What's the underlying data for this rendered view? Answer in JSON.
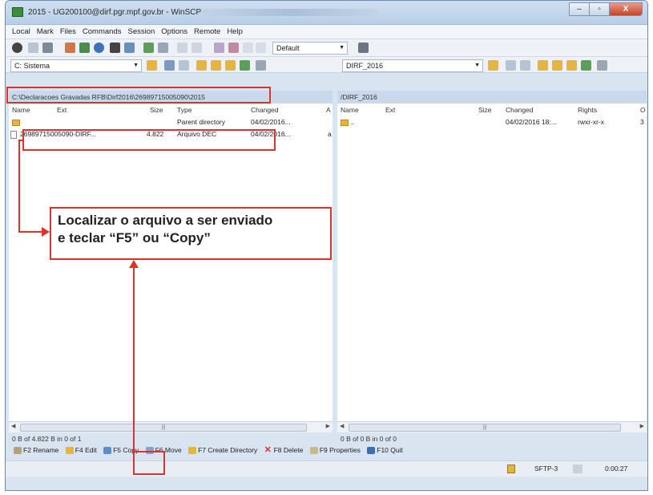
{
  "window": {
    "title": "2015 - UG200100@dirf.pgr.mpf.gov.br - WinSCP",
    "buttons": [
      "–",
      "▫",
      "X"
    ]
  },
  "menu": [
    "Local",
    "Mark",
    "Files",
    "Commands",
    "Session",
    "Options",
    "Remote",
    "Help"
  ],
  "toolbar": {
    "session_combo": "Default"
  },
  "left": {
    "drive_combo": "C: Sistema",
    "path": "C:\\Declaracoes Gravadas RFB\\Dirf2016\\26989715005090\\2015",
    "columns": [
      "Name",
      "Ext",
      "Size",
      "Type",
      "Changed",
      "A"
    ],
    "rows": [
      {
        "name": "",
        "ext": "",
        "size": "",
        "type": "Parent directory",
        "changed": "04/02/2016...",
        "attr": ""
      },
      {
        "name": "26989715005090-DIRF...",
        "ext": "",
        "size": "4.822",
        "type": "Arquivo DEC",
        "changed": "04/02/2016...",
        "attr": "a"
      }
    ],
    "status": "0 B of 4.822 B in 0 of 1"
  },
  "right": {
    "dir_combo": "DIRF_2016",
    "path": "/DIRF_2016",
    "columns": [
      "Name",
      "Ext",
      "Size",
      "Changed",
      "Rights",
      "O"
    ],
    "rows": [
      {
        "name": "..",
        "ext": "",
        "size": "",
        "changed": "04/02/2016 18:...",
        "rights": "rwxr-xr-x",
        "owner": "3"
      }
    ],
    "status": "0 B of 0 B in 0 of 0"
  },
  "fkeys": [
    "F2 Rename",
    "F4 Edit",
    "F5 Copy",
    "F6 Move",
    "F7 Create Directory",
    "F8 Delete",
    "F9 Properties",
    "F10 Quit"
  ],
  "statusbar": {
    "protocol": "SFTP-3",
    "time": "0:00:27"
  },
  "annotation": {
    "line1": "Localizar o arquivo a ser enviado",
    "line2": "e teclar “F5” ou “Copy”"
  },
  "colors": {
    "accent": "#d9342b",
    "pathbar": "#c9d8ea",
    "chrome": "#d9e4f1"
  }
}
